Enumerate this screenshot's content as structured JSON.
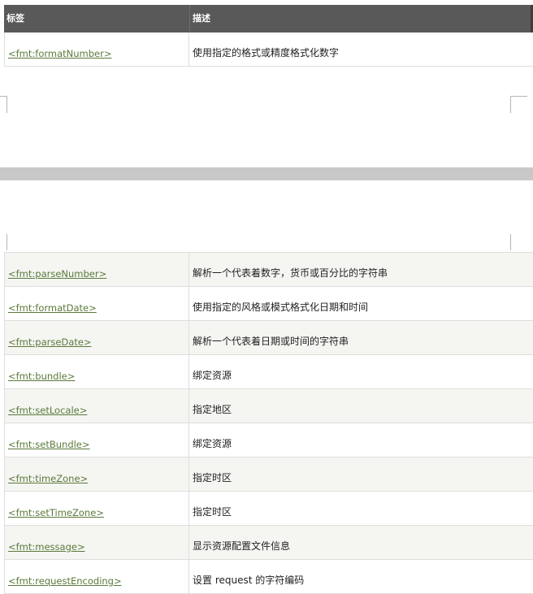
{
  "table": {
    "header": {
      "tag": "标签",
      "description": "描述"
    },
    "rows": [
      {
        "tag": "<fmt:formatNumber>",
        "description": "使用指定的格式或精度格式化数字"
      },
      {
        "tag": "<fmt:parseNumber>",
        "description": "解析一个代表着数字，货币或百分比的字符串"
      },
      {
        "tag": "<fmt:formatDate>",
        "description": "使用指定的风格或模式格式化日期和时间"
      },
      {
        "tag": "<fmt:parseDate>",
        "description": "解析一个代表着日期或时间的字符串"
      },
      {
        "tag": "<fmt:bundle>",
        "description": "绑定资源"
      },
      {
        "tag": "<fmt:setLocale>",
        "description": "指定地区"
      },
      {
        "tag": "<fmt:setBundle>",
        "description": "绑定资源"
      },
      {
        "tag": "<fmt:timeZone>",
        "description": "指定时区"
      },
      {
        "tag": "<fmt:setTimeZone>",
        "description": "指定时区"
      },
      {
        "tag": "<fmt:message>",
        "description": "显示资源配置文件信息"
      },
      {
        "tag": "<fmt:requestEncoding>",
        "description": "设置 request 的字符编码"
      }
    ]
  },
  "colors": {
    "header_bg": "#595959",
    "link": "#5a7a3a",
    "row_alt": "#f5f5f2",
    "page_gap": "#c8c8c8"
  }
}
